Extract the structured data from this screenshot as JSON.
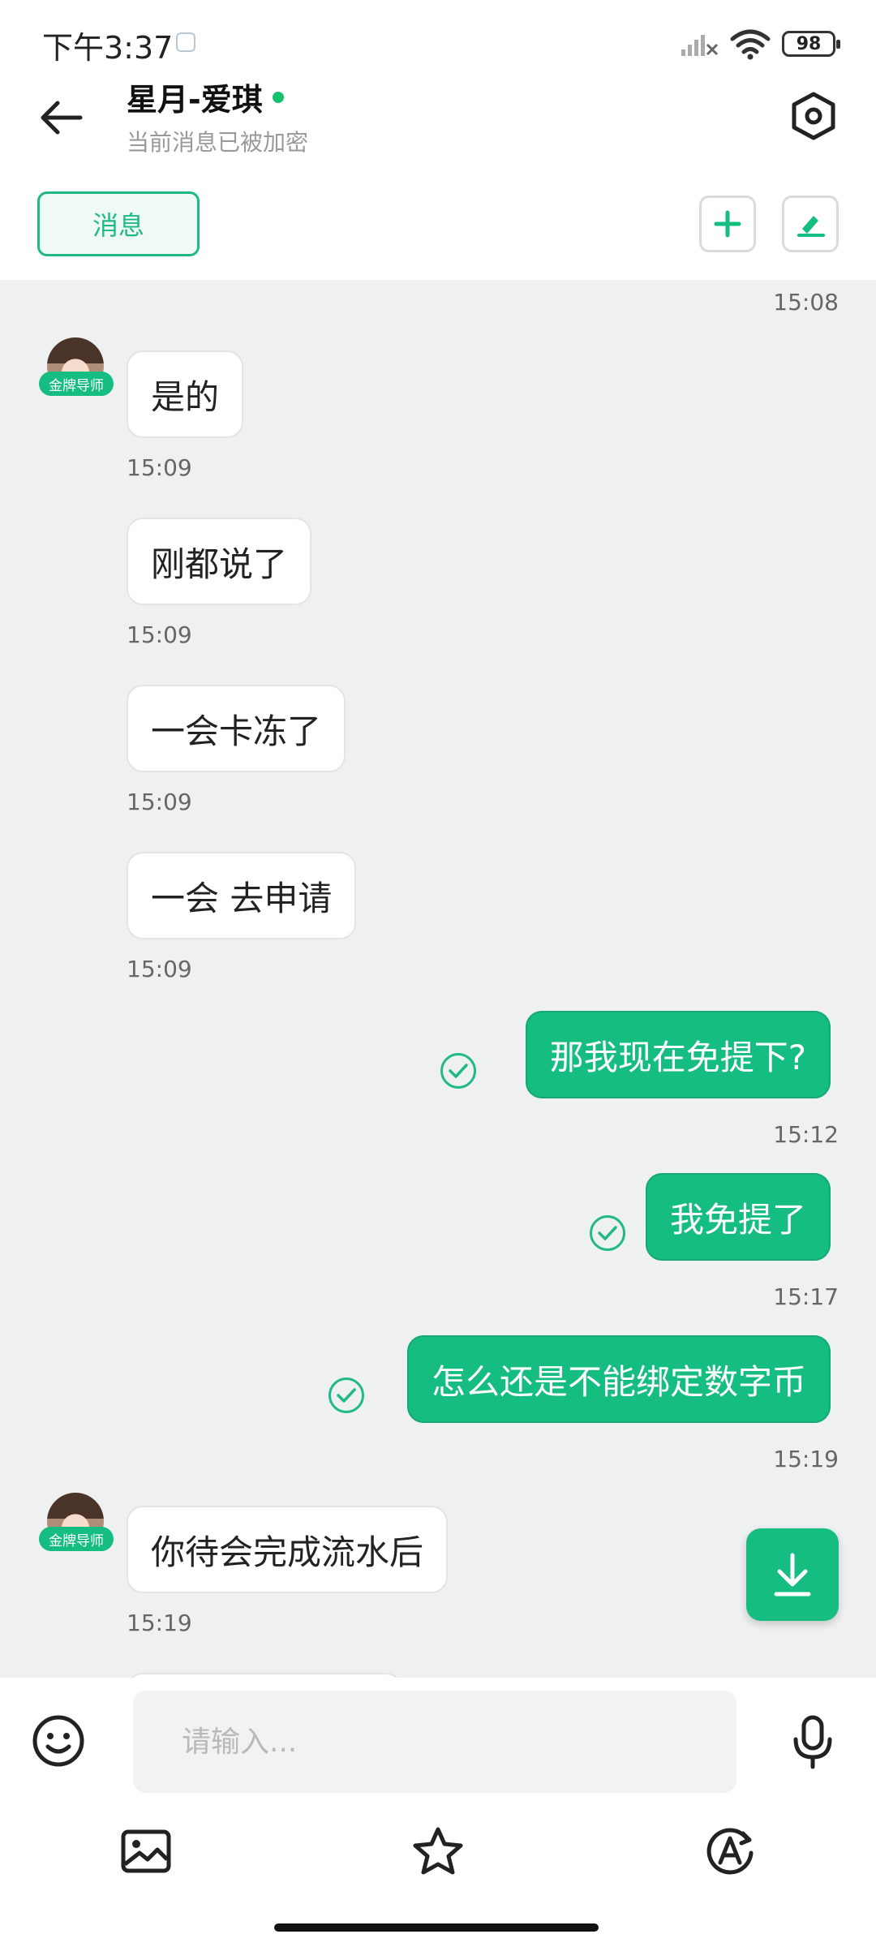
{
  "status_bar": {
    "time": "下午3:37",
    "battery": "98"
  },
  "header": {
    "contact_name": "星月-爱琪",
    "subtitle": "当前消息已被加密",
    "online_color": "#15c26b"
  },
  "tabs": {
    "messages_label": "消息"
  },
  "avatar_badge": "金牌导师",
  "messages": [
    {
      "direction": "in",
      "text": "",
      "time": "15:08"
    },
    {
      "direction": "in",
      "text": "是的",
      "time": "15:09"
    },
    {
      "direction": "in",
      "text": "刚都说了",
      "time": "15:09"
    },
    {
      "direction": "in",
      "text": "一会卡冻了",
      "time": "15:09"
    },
    {
      "direction": "in",
      "text": "一会 去申请",
      "time": "15:09"
    },
    {
      "direction": "out",
      "text": "那我现在免提下?",
      "time": "15:12"
    },
    {
      "direction": "out",
      "text": "我免提了",
      "time": "15:17"
    },
    {
      "direction": "out",
      "text": "怎么还是不能绑定数字币",
      "time": "15:19"
    },
    {
      "direction": "in",
      "text": "你待会完成流水后",
      "time": "15:19"
    }
  ],
  "input": {
    "placeholder": "请输入..."
  },
  "colors": {
    "accent": "#16bd80",
    "background": "#eef0f2"
  },
  "icons": [
    "back-arrow-icon",
    "settings-hexagon-icon",
    "plus-icon",
    "edit-pen-icon",
    "check-circle-icon",
    "download-arrow-icon",
    "emoji-icon",
    "microphone-icon",
    "image-icon",
    "star-icon",
    "translate-icon"
  ]
}
